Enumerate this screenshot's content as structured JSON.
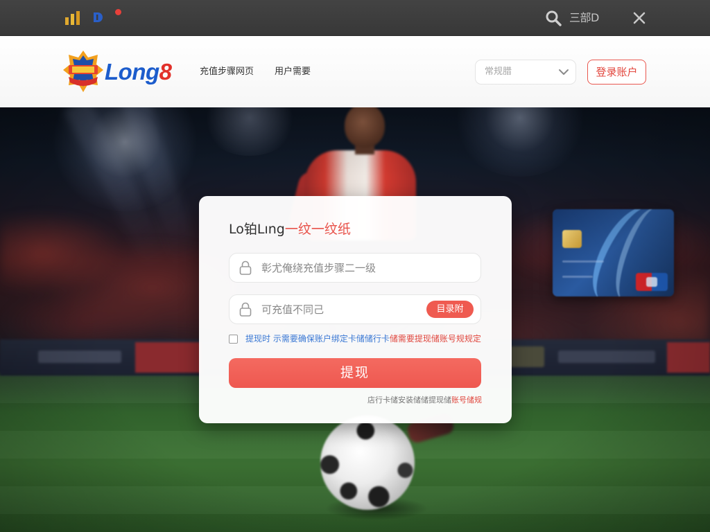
{
  "topbar": {
    "label": "三部D",
    "icons": [
      "bar-chart-icon",
      "d-logo-icon",
      "notification-dot-icon",
      "search-icon",
      "close-icon"
    ]
  },
  "header": {
    "logo": {
      "text_main": "Long",
      "text_accent": "8",
      "icon": "shield-badge-icon"
    },
    "nav": [
      {
        "label": "充值步骤网页"
      },
      {
        "label": "用户需要"
      }
    ],
    "select": {
      "value": "常规腊",
      "icon": "chevron-down-icon"
    },
    "login_label": "登录账户"
  },
  "modal": {
    "title_main": "Lo铂Lıng",
    "title_accent": "一纹一纹纸",
    "fields": [
      {
        "placeholder": "彰尤俺绕充值步骤二一级",
        "icon": "lock-icon"
      },
      {
        "placeholder": "可充值不同己",
        "icon": "lock-icon"
      }
    ],
    "code_button": "目录附",
    "agreement": {
      "checked": false,
      "text": "提现时 示需要确保账户绑定卡储储行卡",
      "text_accent": "储需要提现储账号规规定"
    },
    "submit_label": "提现",
    "footer": {
      "text": "店行卡储安装储储提现储",
      "text_accent": "账号储规"
    }
  },
  "colors": {
    "accent": "#ef5a50",
    "brand_blue": "#1c5ccc",
    "link_blue": "#3a78d4",
    "topbar": "#3c3c3c"
  }
}
